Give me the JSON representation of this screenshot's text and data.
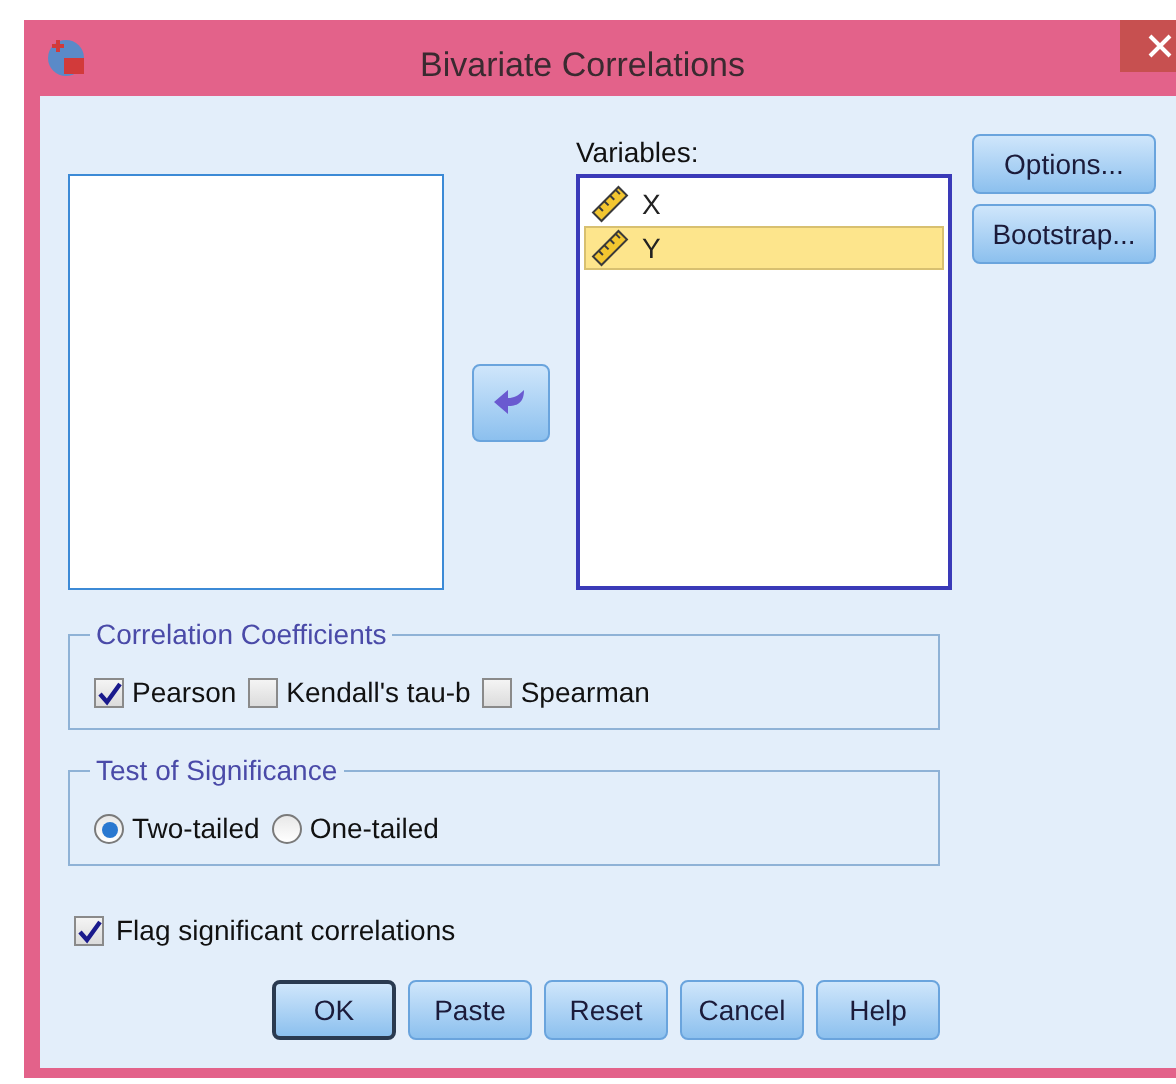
{
  "window": {
    "title": "Bivariate Correlations"
  },
  "move_button": {
    "kind": "left"
  },
  "variables": {
    "label": "Variables:",
    "items": [
      {
        "name": "X",
        "selected": false
      },
      {
        "name": "Y",
        "selected": true
      }
    ]
  },
  "side_buttons": [
    "Options...",
    "Bootstrap..."
  ],
  "correlation_coefficients": {
    "title": "Correlation Coefficients",
    "options": [
      {
        "label": "Pearson",
        "checked": true
      },
      {
        "label": "Kendall's tau-b",
        "checked": false
      },
      {
        "label": "Spearman",
        "checked": false
      }
    ]
  },
  "test_of_significance": {
    "title": "Test of Significance",
    "options": [
      {
        "label": "Two-tailed",
        "selected": true
      },
      {
        "label": "One-tailed",
        "selected": false
      }
    ]
  },
  "flag": {
    "label": "Flag significant correlations",
    "checked": true
  },
  "buttons": [
    {
      "label": "OK",
      "default": true
    },
    {
      "label": "Paste",
      "default": false
    },
    {
      "label": "Reset",
      "default": false
    },
    {
      "label": "Cancel",
      "default": false
    },
    {
      "label": "Help",
      "default": false
    }
  ]
}
